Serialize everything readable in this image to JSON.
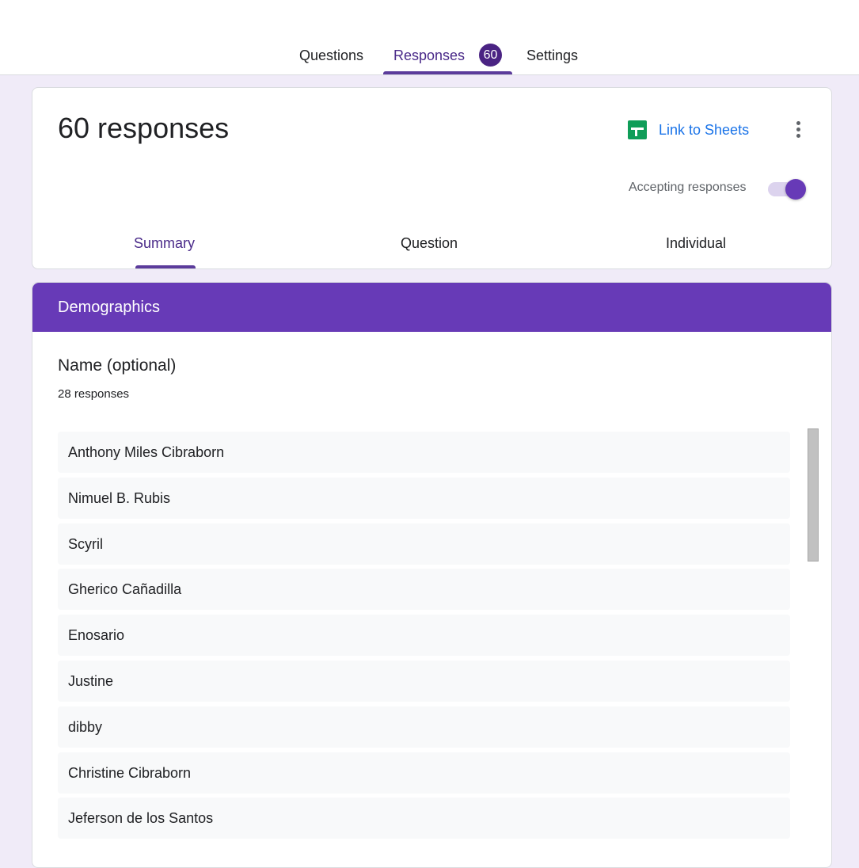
{
  "tabs": {
    "questions": "Questions",
    "responses": "Responses",
    "responses_count": "60",
    "settings": "Settings"
  },
  "summary": {
    "title": "60 responses",
    "link_to_sheets": "Link to Sheets",
    "accepting_label": "Accepting responses",
    "accepting": true,
    "subtabs": [
      "Summary",
      "Question",
      "Individual"
    ],
    "active_subtab": "Summary"
  },
  "section": {
    "title": "Demographics",
    "question": "Name (optional)",
    "response_count": "28 responses",
    "answers": [
      "Anthony Miles Cibraborn",
      "Nimuel B. Rubis",
      "Scyril",
      "Gherico Cañadilla",
      "Enosario",
      "Justine",
      "dibby",
      "Christine Cibraborn",
      "Jeferson de los Santos"
    ]
  },
  "colors": {
    "accent": "#673ab7",
    "active_tab": "#4a2a89",
    "link": "#1a73e8",
    "sheets_green": "#0f9d58",
    "background": "#f0ebf8"
  },
  "icons": [
    "sheets-icon",
    "more-vert-icon"
  ]
}
